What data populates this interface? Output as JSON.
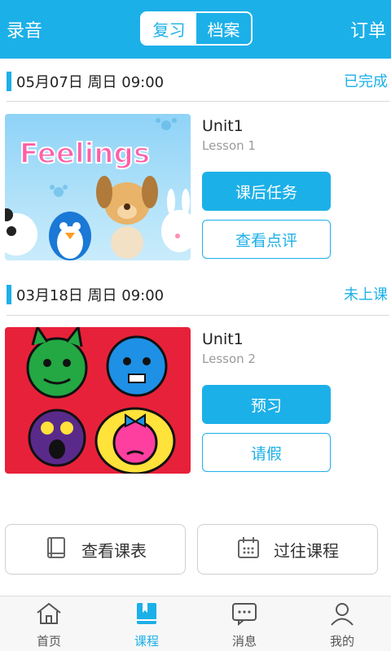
{
  "header": {
    "left_label": "录音",
    "right_label": "订单",
    "segments": [
      {
        "label": "复习",
        "active": true
      },
      {
        "label": "档案",
        "active": false
      }
    ],
    "color": "#1cb0e8"
  },
  "sessions": [
    {
      "date": "05月07日 周日 09:00",
      "status": "已完成",
      "unit": "Unit1",
      "lesson": "Lesson 1",
      "image_title": "Feelings",
      "primary_button": "课后任务",
      "secondary_button": "查看点评"
    },
    {
      "date": "03月18日 周日 09:00",
      "status": "未上课",
      "unit": "Unit1",
      "lesson": "Lesson 2",
      "primary_button": "预习",
      "secondary_button": "请假"
    }
  ],
  "bottom_actions": [
    {
      "label": "查看课表",
      "icon": "book-icon"
    },
    {
      "label": "过往课程",
      "icon": "calendar-icon"
    }
  ],
  "tabbar": [
    {
      "label": "首页",
      "icon": "home-icon",
      "active": false
    },
    {
      "label": "课程",
      "icon": "course-book-icon",
      "active": true
    },
    {
      "label": "消息",
      "icon": "message-icon",
      "active": false
    },
    {
      "label": "我的",
      "icon": "user-icon",
      "active": false
    }
  ]
}
